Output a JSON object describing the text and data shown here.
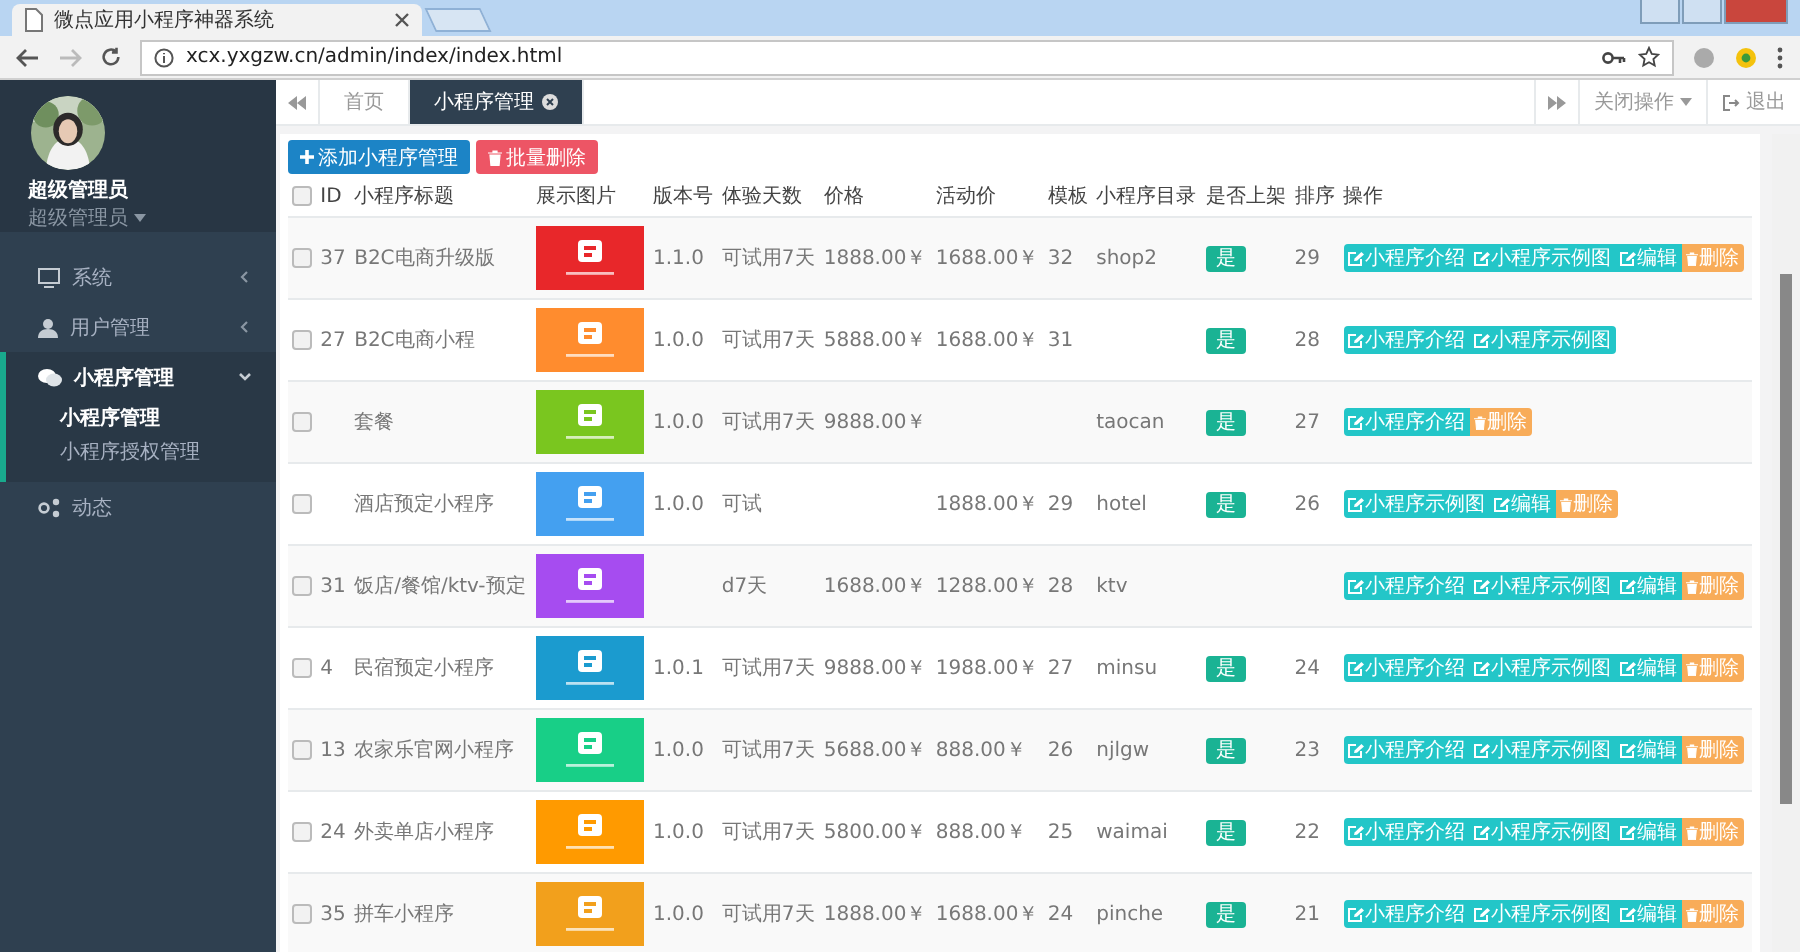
{
  "browser": {
    "tab_title": "微点应用小程序神器系统",
    "url": "xcx.yxgzw.cn/admin/index/index.html"
  },
  "sidebar": {
    "user_name": "超级管理员",
    "user_role": "超级管理员",
    "menu": [
      {
        "label": "系统",
        "expanded": false,
        "selected": false
      },
      {
        "label": "用户管理",
        "expanded": false,
        "selected": false
      },
      {
        "label": "小程序管理",
        "expanded": true,
        "selected": true,
        "children": [
          {
            "label": "小程序管理",
            "selected": true
          },
          {
            "label": "小程序授权管理",
            "selected": false
          }
        ]
      },
      {
        "label": "动态",
        "selected": false
      }
    ]
  },
  "top_tabs": [
    {
      "label": "首页",
      "selected": false,
      "closable": false
    },
    {
      "label": "小程序管理",
      "selected": true,
      "closable": true
    }
  ],
  "top_actions": {
    "close_menu": "关闭操作",
    "logout": "退出"
  },
  "toolbar": [
    {
      "label": "添加小程序管理",
      "kind": "add"
    },
    {
      "label": "批量删除",
      "kind": "delete"
    }
  ],
  "table": {
    "header_checked": false,
    "columns": [
      "ID",
      "小程序标题",
      "展示图片",
      "版本号",
      "体验天数",
      "价格",
      "活动价",
      "模板",
      "小程序目录",
      "是否上架",
      "排序",
      "操作"
    ],
    "rows": [
      {
        "checked": false,
        "id": "37",
        "title": "B2C电商升级版",
        "version": "1.1.0",
        "trial": "可试用7天",
        "price": "1888.00￥",
        "promo": "1688.00￥",
        "template": "32",
        "directory": "shop2",
        "on_shelf": "是",
        "sort": "29",
        "actions": [
          {
            "label": "小程序介绍",
            "kind": "edit"
          },
          {
            "label": "小程序示例图",
            "kind": "edit"
          },
          {
            "label": "编辑",
            "kind": "edit"
          },
          {
            "label": "删除",
            "kind": "delete"
          }
        ]
      },
      {
        "checked": false,
        "id": "27",
        "title": "B2C电商小程",
        "version": "1.0.0",
        "trial": "可试用7天",
        "price": "5888.00￥",
        "promo": "1688.00￥",
        "template": "31",
        "on_shelf": "是",
        "sort": "28",
        "actions": [
          {
            "label": "小程序介绍",
            "kind": "edit"
          },
          {
            "label": "小程序示例图",
            "kind": "edit"
          }
        ]
      },
      {
        "checked": false,
        "title": "套餐",
        "version": "1.0.0",
        "trial": "可试用7天",
        "price": "9888.00￥",
        "directory": "taocan",
        "on_shelf": "是",
        "sort": "27",
        "actions": [
          {
            "label": "小程序介绍",
            "kind": "edit"
          },
          {
            "label": "删除",
            "kind": "delete"
          }
        ]
      },
      {
        "checked": false,
        "title": "酒店预定小程序",
        "version": "1.0.0",
        "trial": "可试",
        "promo": "1888.00￥",
        "template": "29",
        "directory": "hotel",
        "on_shelf": "是",
        "sort": "26",
        "actions": [
          {
            "label": "小程序示例图",
            "kind": "edit"
          },
          {
            "label": "编辑",
            "kind": "edit"
          },
          {
            "label": "删除",
            "kind": "delete"
          }
        ]
      },
      {
        "checked": false,
        "id": "31",
        "title": "饭店/餐馆/ktv-预定",
        "trial": "d7天",
        "price": "1688.00￥",
        "promo": "1288.00￥",
        "template": "28",
        "directory": "ktv",
        "actions": [
          {
            "label": "小程序介绍",
            "kind": "edit"
          },
          {
            "label": "小程序示例图",
            "kind": "edit"
          },
          {
            "label": "编辑",
            "kind": "edit"
          },
          {
            "label": "删除",
            "kind": "delete"
          }
        ]
      },
      {
        "checked": false,
        "id": "4",
        "title": "民宿预定小程序",
        "version": "1.0.1",
        "trial": "可试用7天",
        "price": "9888.00￥",
        "promo": "1988.00￥",
        "template": "27",
        "directory": "minsu",
        "on_shelf": "是",
        "sort": "24",
        "actions": [
          {
            "label": "小程序介绍",
            "kind": "edit"
          },
          {
            "label": "小程序示例图",
            "kind": "edit"
          },
          {
            "label": "编辑",
            "kind": "edit"
          },
          {
            "label": "删除",
            "kind": "delete"
          }
        ]
      },
      {
        "checked": false,
        "id": "13",
        "title": "农家乐官网小程序",
        "version": "1.0.0",
        "trial": "可试用7天",
        "price": "5688.00￥",
        "promo": "888.00￥",
        "template": "26",
        "directory": "njlgw",
        "on_shelf": "是",
        "sort": "23",
        "actions": [
          {
            "label": "小程序介绍",
            "kind": "edit"
          },
          {
            "label": "小程序示例图",
            "kind": "edit"
          },
          {
            "label": "编辑",
            "kind": "edit"
          },
          {
            "label": "删除",
            "kind": "delete"
          }
        ]
      },
      {
        "checked": false,
        "id": "24",
        "title": "外卖单店小程序",
        "version": "1.0.0",
        "trial": "可试用7天",
        "price": "5800.00￥",
        "promo": "888.00￥",
        "template": "25",
        "directory": "waimai",
        "on_shelf": "是",
        "sort": "22",
        "actions": [
          {
            "label": "小程序介绍",
            "kind": "edit"
          },
          {
            "label": "小程序示例图",
            "kind": "edit"
          },
          {
            "label": "编辑",
            "kind": "edit"
          },
          {
            "label": "删除",
            "kind": "delete"
          }
        ]
      },
      {
        "checked": false,
        "id": "35",
        "title": "拼车小程序",
        "version": "1.0.0",
        "trial": "可试用7天",
        "price": "1888.00￥",
        "promo": "1688.00￥",
        "template": "24",
        "directory": "pinche",
        "on_shelf": "是",
        "sort": "21",
        "actions": [
          {
            "label": "小程序介绍",
            "kind": "edit"
          },
          {
            "label": "小程序示例图",
            "kind": "edit"
          },
          {
            "label": "编辑",
            "kind": "edit"
          },
          {
            "label": "删除",
            "kind": "delete"
          }
        ]
      }
    ]
  }
}
